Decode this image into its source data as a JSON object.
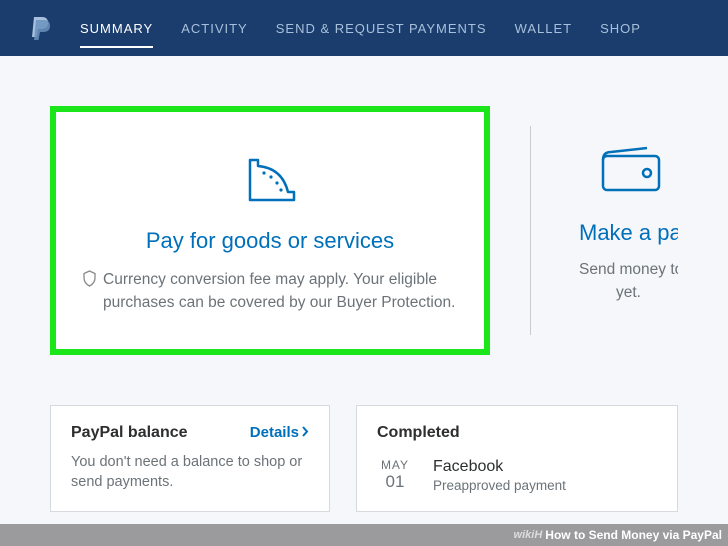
{
  "nav": {
    "items": [
      "SUMMARY",
      "ACTIVITY",
      "SEND & REQUEST PAYMENTS",
      "WALLET",
      "SHOP"
    ],
    "activeIndex": 0
  },
  "cards": {
    "pay_goods": {
      "title": "Pay for goods or services",
      "desc": "Currency conversion fee may apply. Your eligible purchases can be covered by our Buyer Protection."
    },
    "make_payment": {
      "title": "Make a payment in",
      "desc_line1": "Send money to a friend, even",
      "desc_line2": "yet."
    }
  },
  "balance": {
    "title": "PayPal balance",
    "details_label": "Details",
    "desc": "You don't need a balance to shop or send payments."
  },
  "completed": {
    "title": "Completed",
    "transactions": [
      {
        "month": "MAY",
        "day": "01",
        "merchant": "Facebook",
        "type": "Preapproved payment"
      }
    ]
  },
  "footer": {
    "source": "wikiH",
    "title": "How to Send Money via PayPal"
  }
}
